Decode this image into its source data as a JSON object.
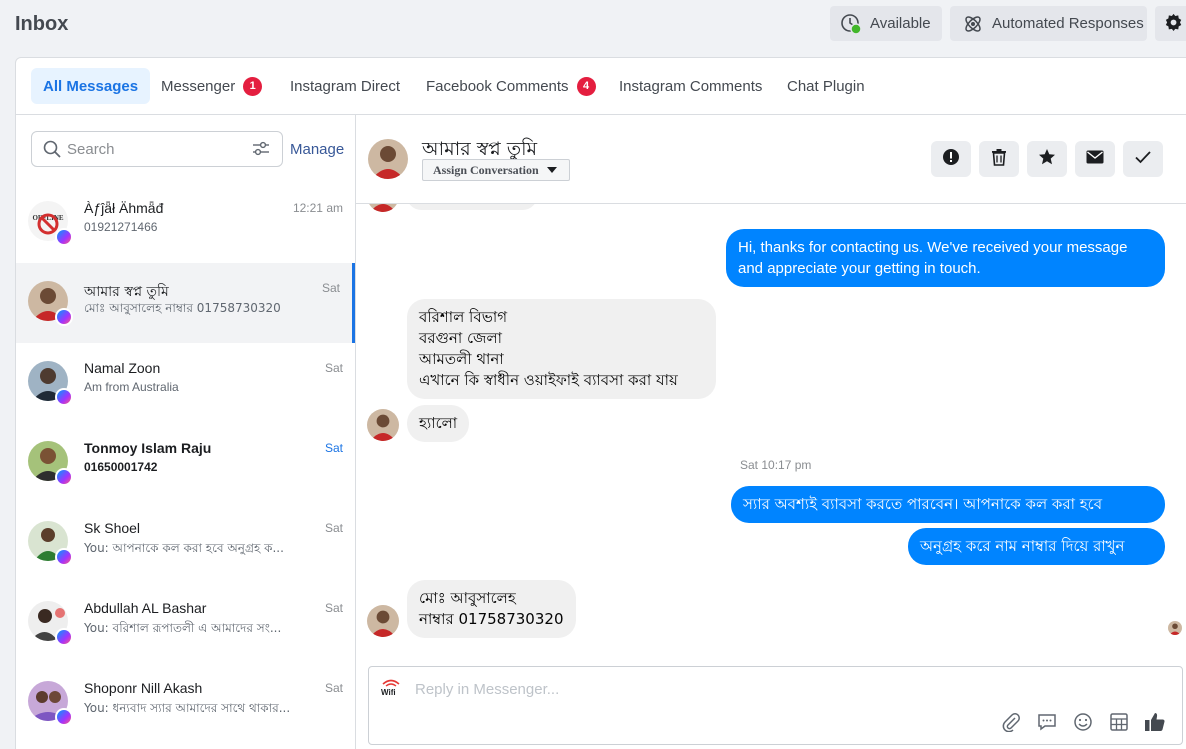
{
  "topbar": {
    "title": "Inbox",
    "available_label": "Available",
    "automated_label": "Automated Responses"
  },
  "tabs": [
    {
      "label": "All Messages",
      "badge": null
    },
    {
      "label": "Messenger",
      "badge": "1"
    },
    {
      "label": "Instagram Direct",
      "badge": null
    },
    {
      "label": "Facebook Comments",
      "badge": "4"
    },
    {
      "label": "Instagram Comments",
      "badge": null
    },
    {
      "label": "Chat Plugin",
      "badge": null
    }
  ],
  "search": {
    "placeholder": "Search",
    "value": ""
  },
  "manage_label": "Manage",
  "conversations": [
    {
      "name": "Àƒĵǟł Ähmǟđ",
      "preview": "01921271466",
      "time": "12:21 am"
    },
    {
      "name": "আমার স্বপ্ন তুমি",
      "preview": "মোঃ আবুসালেহ নাম্বার 01758730320",
      "time": "Sat"
    },
    {
      "name": "Namal Zoon",
      "preview": "Am from Australia",
      "time": "Sat"
    },
    {
      "name": "Tonmoy Islam Raju",
      "preview": "01650001742",
      "time": "Sat"
    },
    {
      "name": "Sk Shoel",
      "preview": "You: আপনাকে কল করা হবে অনুগ্রহ ক...",
      "time": "Sat"
    },
    {
      "name": "Abdullah AL Bashar",
      "preview": "You: বরিশাল রূপাতলী এ আমাদের সং...",
      "time": "Sat"
    },
    {
      "name": "Shoponr Nill Akash",
      "preview": "You: ধন্যবাদ স্যার আমাদের সাথে থাকার...",
      "time": "Sat"
    }
  ],
  "header": {
    "name": "আমার স্বপ্ন তুমি",
    "assign_label": "Assign Conversation"
  },
  "messages": {
    "out1": "Hi, thanks for contacting us. We've received your message and appreciate your getting in touch.",
    "in1_line1": "বরিশাল বিভাগ",
    "in1_line2": "বরগুনা জেলা",
    "in1_line3": "আমতলী থানা",
    "in1_line4": "এখানে কি স্বাধীন ওয়াইফাই ব্যাবসা করা যায়",
    "in2": "হ্যালো",
    "timestamp": "Sat 10:17 pm",
    "out2": "স্যার অবশ্যই ব্যাবসা করতে পারবেন। আপনাকে কল করা হবে",
    "out3": "অনুগ্রহ করে নাম নাম্বার দিয়ে রাখুন",
    "in3_line1": "মোঃ আবুসালেহ",
    "in3_line2": "নাম্বার 01758730320"
  },
  "composer": {
    "placeholder": "Reply in Messenger...",
    "value": "",
    "page_logo": "Wifi"
  },
  "colors": {
    "accent": "#1b74e4",
    "bubble_out": "#0084ff",
    "bubble_in": "#f0f0f0",
    "badge": "#e41e3f",
    "status_green": "#42b72a"
  }
}
